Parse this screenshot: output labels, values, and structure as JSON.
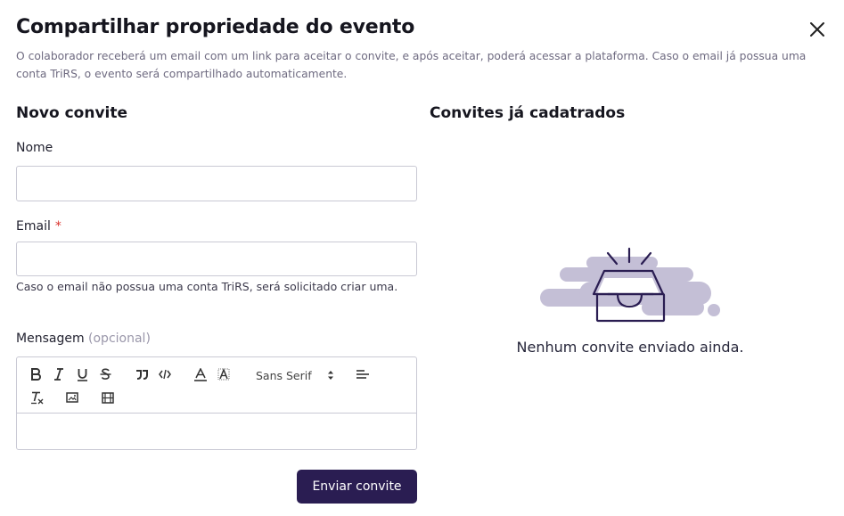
{
  "modal": {
    "title": "Compartilhar propriedade do evento",
    "subtitle": "O colaborador receberá um email com um link para aceitar o convite, e após aceitar, poderá acessar a plataforma. Caso o email já possua uma conta TriRS, o evento será compartilhado automaticamente.",
    "close_icon": "close-icon"
  },
  "new_invite": {
    "section_title": "Novo convite",
    "name_label": "Nome",
    "name_value": "",
    "email_label": "Email",
    "email_required_mark": "*",
    "email_value": "",
    "email_hint": "Caso o email não possua uma conta TriRS, será solicitado criar uma.",
    "message_label": "Mensagem",
    "message_optional": "(opcional)",
    "message_value": "",
    "editor_toolbar": {
      "font": "Sans Serif",
      "icons": [
        "bold-icon",
        "italic-icon",
        "underline-icon",
        "strike-icon",
        "blockquote-icon",
        "code-block-icon",
        "text-color-icon",
        "background-color-icon",
        "font-select",
        "align-icon",
        "clear-format-icon",
        "image-icon",
        "video-icon"
      ]
    },
    "submit_label": "Enviar convite"
  },
  "existing_invites": {
    "section_title": "Convites já cadatrados",
    "empty_text": "Nenhum convite enviado ainda.",
    "empty_icon": "empty-inbox-icon"
  },
  "colors": {
    "primary": "#2a1d52",
    "required": "#d9322c",
    "illustration_bg": "#c4bfd6",
    "illustration_line": "#2a1d52"
  }
}
